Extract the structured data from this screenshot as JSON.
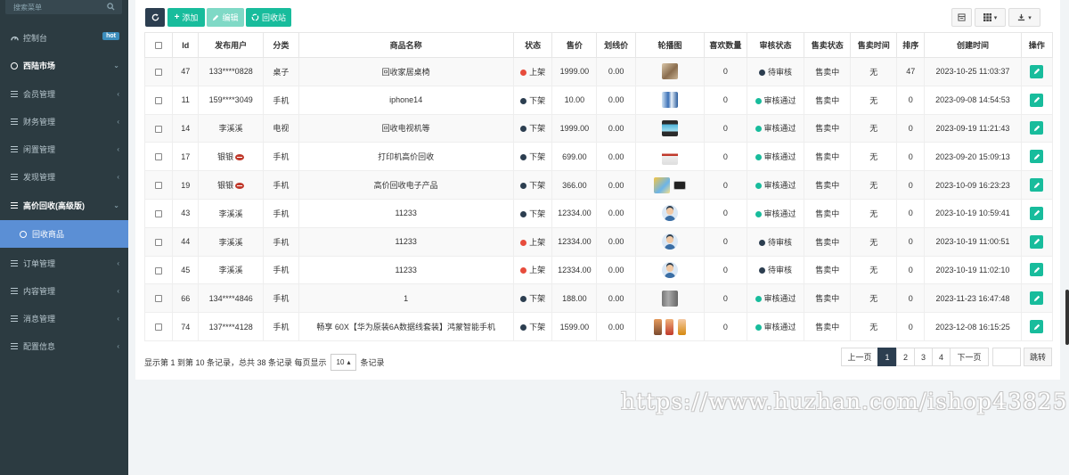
{
  "sidebar": {
    "search_placeholder": "搜索菜单",
    "items": [
      {
        "label": "控制台",
        "badge": "hot"
      },
      {
        "label": "西陆市场"
      },
      {
        "label": "会员管理"
      },
      {
        "label": "财务管理"
      },
      {
        "label": "闲置管理"
      },
      {
        "label": "发现管理"
      },
      {
        "label": "高价回收(高级版)"
      },
      {
        "label": "回收商品"
      },
      {
        "label": "订单管理"
      },
      {
        "label": "内容管理"
      },
      {
        "label": "消息管理"
      },
      {
        "label": "配置信息"
      }
    ]
  },
  "toolbar": {
    "add": "添加",
    "edit": "编辑",
    "recycle": "回收站"
  },
  "table": {
    "headers": [
      "Id",
      "发布用户",
      "分类",
      "商品名称",
      "状态",
      "售价",
      "划线价",
      "轮播图",
      "喜欢数量",
      "审核状态",
      "售卖状态",
      "售卖时间",
      "排序",
      "创建时间",
      "操作"
    ],
    "rows": [
      {
        "id": "47",
        "user": "133****0828",
        "category": "桌子",
        "name": "回收家居桌椅",
        "status": "上架",
        "price": "1999.00",
        "strike": "0.00",
        "likes": "0",
        "audit": "待审核",
        "sale": "售卖中",
        "sale_time": "无",
        "sort": "47",
        "created": "2023-10-25 11:03:37"
      },
      {
        "id": "11",
        "user": "159****3049",
        "category": "手机",
        "name": "iphone14",
        "status": "下架",
        "price": "10.00",
        "strike": "0.00",
        "likes": "0",
        "audit": "审核通过",
        "sale": "售卖中",
        "sale_time": "无",
        "sort": "0",
        "created": "2023-09-08 14:54:53"
      },
      {
        "id": "14",
        "user": "李溪溪",
        "category": "电视",
        "name": "回收电视机等",
        "status": "下架",
        "price": "1999.00",
        "strike": "0.00",
        "likes": "0",
        "audit": "审核通过",
        "sale": "售卖中",
        "sale_time": "无",
        "sort": "0",
        "created": "2023-09-19 11:21:43"
      },
      {
        "id": "17",
        "user": "银银",
        "category": "手机",
        "name": "打印机高价回收",
        "status": "下架",
        "price": "699.00",
        "strike": "0.00",
        "likes": "0",
        "audit": "审核通过",
        "sale": "售卖中",
        "sale_time": "无",
        "sort": "0",
        "created": "2023-09-20 15:09:13"
      },
      {
        "id": "19",
        "user": "银银",
        "category": "手机",
        "name": "高价回收电子产品",
        "status": "下架",
        "price": "366.00",
        "strike": "0.00",
        "likes": "0",
        "audit": "审核通过",
        "sale": "售卖中",
        "sale_time": "无",
        "sort": "0",
        "created": "2023-10-09 16:23:23"
      },
      {
        "id": "43",
        "user": "李溪溪",
        "category": "手机",
        "name": "11233",
        "status": "下架",
        "price": "12334.00",
        "strike": "0.00",
        "likes": "0",
        "audit": "审核通过",
        "sale": "售卖中",
        "sale_time": "无",
        "sort": "0",
        "created": "2023-10-19 10:59:41"
      },
      {
        "id": "44",
        "user": "李溪溪",
        "category": "手机",
        "name": "11233",
        "status": "上架",
        "price": "12334.00",
        "strike": "0.00",
        "likes": "0",
        "audit": "待审核",
        "sale": "售卖中",
        "sale_time": "无",
        "sort": "0",
        "created": "2023-10-19 11:00:51"
      },
      {
        "id": "45",
        "user": "李溪溪",
        "category": "手机",
        "name": "11233",
        "status": "上架",
        "price": "12334.00",
        "strike": "0.00",
        "likes": "0",
        "audit": "待审核",
        "sale": "售卖中",
        "sale_time": "无",
        "sort": "0",
        "created": "2023-10-19 11:02:10"
      },
      {
        "id": "66",
        "user": "134****4846",
        "category": "手机",
        "name": "1",
        "status": "下架",
        "price": "188.00",
        "strike": "0.00",
        "likes": "0",
        "audit": "审核通过",
        "sale": "售卖中",
        "sale_time": "无",
        "sort": "0",
        "created": "2023-11-23 16:47:48"
      },
      {
        "id": "74",
        "user": "137****4128",
        "category": "手机",
        "name": "畅享 60X【华为原装6A数据线套装】鸿蒙智能手机",
        "status": "下架",
        "price": "1599.00",
        "strike": "0.00",
        "likes": "0",
        "audit": "审核通过",
        "sale": "售卖中",
        "sale_time": "无",
        "sort": "0",
        "created": "2023-12-08 16:15:25"
      }
    ]
  },
  "footer": {
    "summary": "显示第 1 到第 10 条记录，总共 38 条记录 每页显示",
    "per_page": "10",
    "per_page_suffix": "条记录",
    "prev": "上一页",
    "pages": [
      "1",
      "2",
      "3",
      "4"
    ],
    "next": "下一页",
    "jump": "跳转"
  },
  "watermark": "https://www.huzhan.com/ishop43825",
  "colors": {
    "sidebar_bg": "#2c3b41",
    "active_nav": "#5b8fd5",
    "primary": "#18bc9c",
    "dark": "#2c3e50",
    "danger": "#e74c3c"
  }
}
